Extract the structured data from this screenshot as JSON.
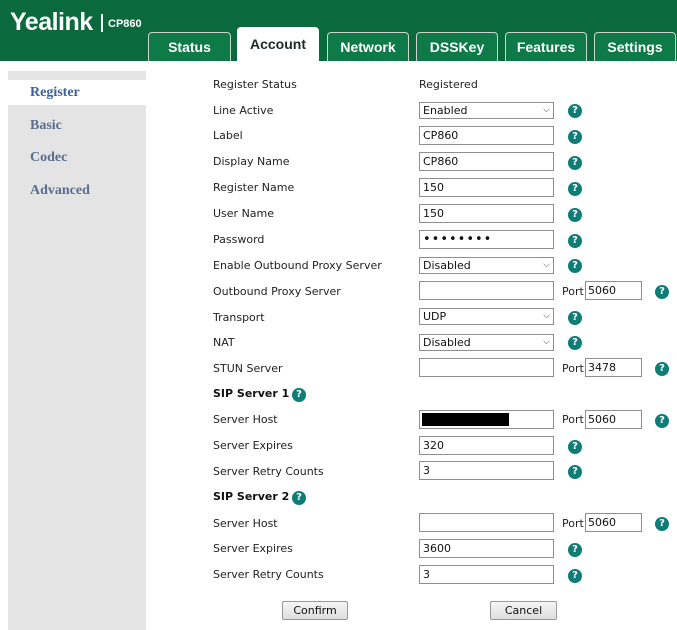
{
  "header": {
    "brand": "Yealink",
    "model": "CP860",
    "tabs": [
      "Status",
      "Account",
      "Network",
      "DSSKey",
      "Features",
      "Settings"
    ],
    "active_tab": "Account"
  },
  "leftnav": {
    "items": [
      "Register",
      "Basic",
      "Codec",
      "Advanced"
    ],
    "active": "Register"
  },
  "form": {
    "register_status": {
      "label": "Register Status",
      "value": "Registered"
    },
    "line_active": {
      "label": "Line Active",
      "value": "Enabled"
    },
    "label": {
      "label": "Label",
      "value": "CP860"
    },
    "display_name": {
      "label": "Display Name",
      "value": "CP860"
    },
    "register_name": {
      "label": "Register Name",
      "value": "150"
    },
    "user_name": {
      "label": "User Name",
      "value": "150"
    },
    "password": {
      "label": "Password",
      "value": "••••••••"
    },
    "outbound_proxy_enable": {
      "label": "Enable Outbound Proxy Server",
      "value": "Disabled"
    },
    "outbound_proxy_server": {
      "label": "Outbound Proxy Server",
      "value": "",
      "port_label": "Port",
      "port": "5060"
    },
    "transport": {
      "label": "Transport",
      "value": "UDP"
    },
    "nat": {
      "label": "NAT",
      "value": "Disabled"
    },
    "stun_server": {
      "label": "STUN Server",
      "value": "",
      "port_label": "Port",
      "port": "3478"
    },
    "sip_server_1": {
      "title": "SIP Server 1",
      "host_label": "Server Host",
      "host": "",
      "port_label": "Port",
      "port": "5060",
      "expires_label": "Server Expires",
      "expires": "320",
      "retry_label": "Server Retry Counts",
      "retry": "3"
    },
    "sip_server_2": {
      "title": "SIP Server 2",
      "host_label": "Server Host",
      "host": "",
      "port_label": "Port",
      "port": "5060",
      "expires_label": "Server Expires",
      "expires": "3600",
      "retry_label": "Server Retry Counts",
      "retry": "3"
    }
  },
  "buttons": {
    "confirm": "Confirm",
    "cancel": "Cancel"
  },
  "icons": {
    "help": "?",
    "chevron": "⌵",
    "help_icon_name": "help-icon",
    "chevron_icon_name": "chevron-down-icon"
  },
  "colors": {
    "header": "#0b6a3d",
    "tab": "#0e7a48",
    "help": "#0e7d76",
    "nav_text": "#5a6e90"
  }
}
